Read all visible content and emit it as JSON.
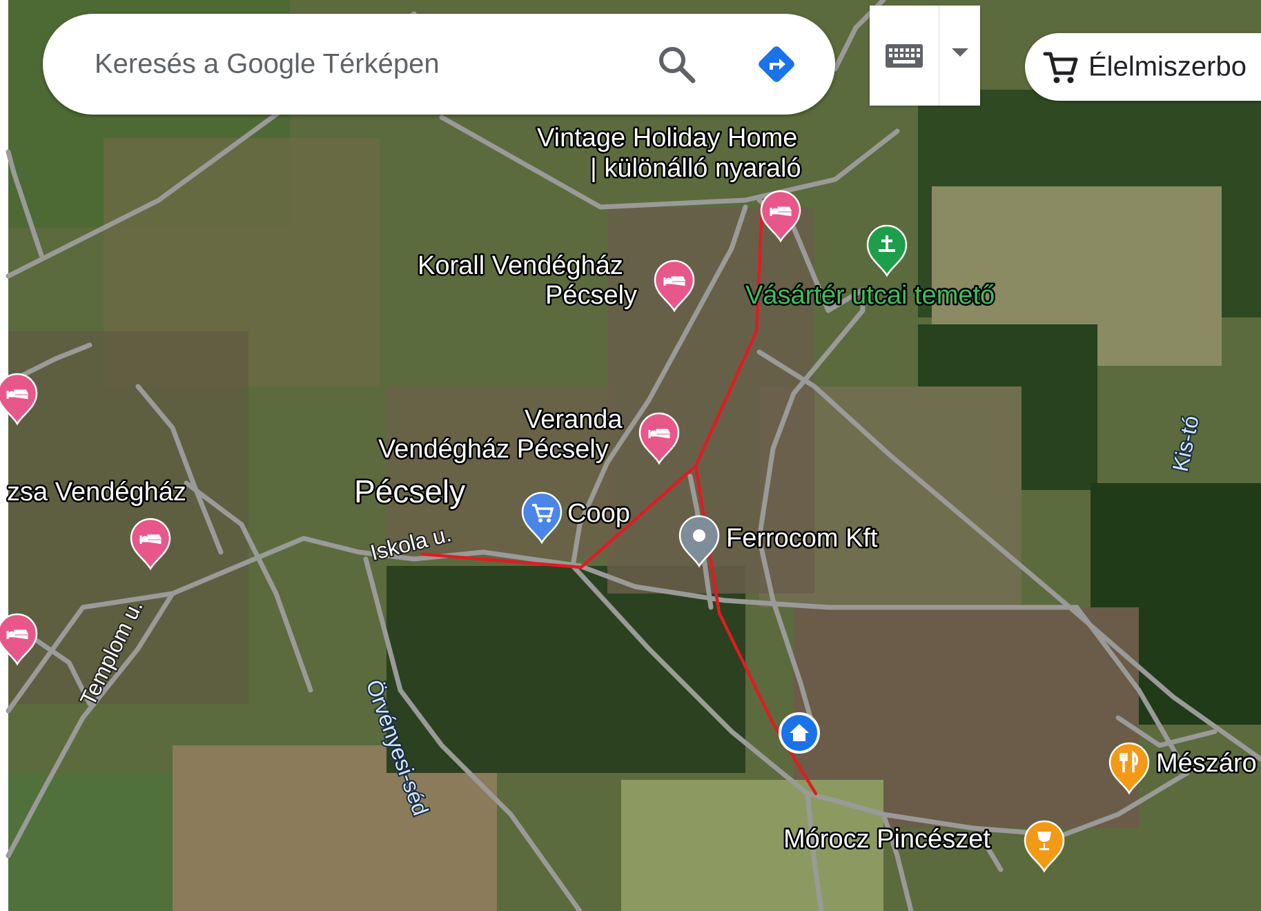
{
  "search": {
    "placeholder": "Keresés a Google Térképen",
    "search_icon": "search-icon",
    "directions_icon": "directions-icon"
  },
  "toolbar": {
    "keyboard_icon": "keyboard-icon",
    "dropdown_icon": "chevron-down-icon"
  },
  "category_chip": {
    "icon": "cart-icon",
    "label": "Élelmiszerbo"
  },
  "map": {
    "place_labels": [
      {
        "id": "vintage1",
        "text": "Vintage Holiday Home"
      },
      {
        "id": "vintage2",
        "text": "| különálló nyaraló"
      },
      {
        "id": "korall1",
        "text": "Korall Vendégház"
      },
      {
        "id": "korall2",
        "text": "Pécsely"
      },
      {
        "id": "vasarter",
        "text": "Vásártér utcai temető"
      },
      {
        "id": "veranda1",
        "text": "Veranda"
      },
      {
        "id": "veranda2",
        "text": "Vendégház Pécsely"
      },
      {
        "id": "pecsely",
        "text": "Pécsely"
      },
      {
        "id": "coop",
        "text": "Coop"
      },
      {
        "id": "ferrocom",
        "text": "Ferrocom Kft"
      },
      {
        "id": "zsa",
        "text": "zsa Vendégház"
      },
      {
        "id": "meszaro",
        "text": "Mészáro"
      },
      {
        "id": "morocz",
        "text": "Mórocz Pincészet"
      }
    ],
    "road_labels": [
      {
        "id": "iskola",
        "text": "Iskola u."
      },
      {
        "id": "templom",
        "text": "Templom u."
      }
    ],
    "water_labels": [
      {
        "id": "orvenyesi",
        "text": "Örvényesi-séd"
      },
      {
        "id": "kisto",
        "text": "Kis-tó"
      }
    ],
    "markers": [
      {
        "id": "vintage",
        "icon": "hotel-icon",
        "color": "#e8578a"
      },
      {
        "id": "korall",
        "icon": "hotel-icon",
        "color": "#e8578a"
      },
      {
        "id": "veranda",
        "icon": "hotel-icon",
        "color": "#e8578a"
      },
      {
        "id": "hotel-left-1",
        "icon": "hotel-icon",
        "color": "#e8578a"
      },
      {
        "id": "hotel-left-2",
        "icon": "hotel-icon",
        "color": "#e8578a"
      },
      {
        "id": "hotel-left-3",
        "icon": "hotel-icon",
        "color": "#e8578a"
      },
      {
        "id": "cemetery",
        "icon": "cemetery-icon",
        "color": "#1e9e4a"
      },
      {
        "id": "coop",
        "icon": "shopping-cart-icon",
        "color": "#4a86e8"
      },
      {
        "id": "ferrocom",
        "icon": "place-icon",
        "color": "#7f8c99"
      },
      {
        "id": "home",
        "icon": "home-icon",
        "color": "#1a73e8"
      },
      {
        "id": "meszaro",
        "icon": "restaurant-icon",
        "color": "#f29a16"
      },
      {
        "id": "morocz",
        "icon": "winery-icon",
        "color": "#f29a16"
      }
    ],
    "route_color": "#e11b22"
  }
}
